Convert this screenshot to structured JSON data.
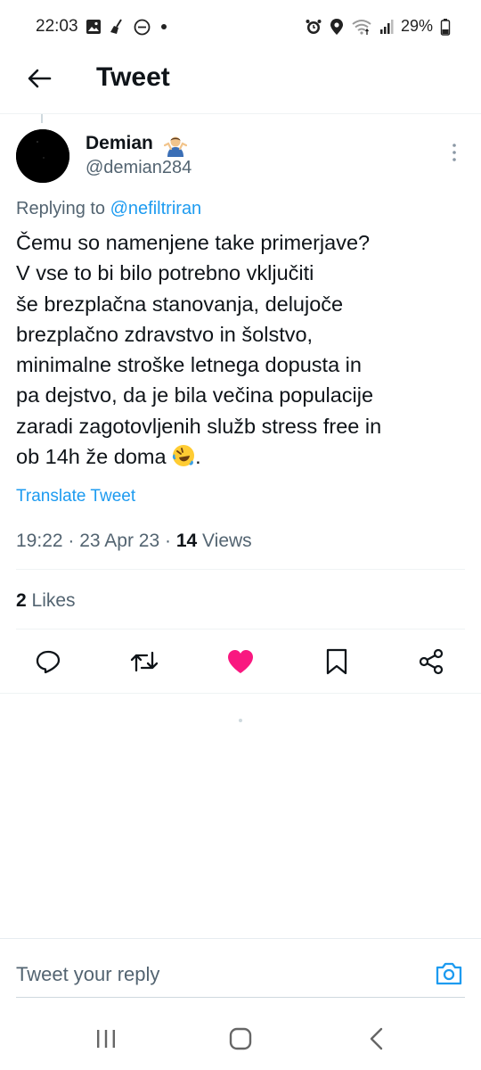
{
  "status_bar": {
    "time": "22:03",
    "battery": "29%",
    "left_icons": [
      "gallery-icon",
      "broom-icon",
      "do-not-disturb-icon",
      "dot-icon"
    ],
    "right_icons": [
      "alarm-icon",
      "location-icon",
      "wifi-icon",
      "signal-icon",
      "battery-icon"
    ]
  },
  "header": {
    "title": "Tweet",
    "back_icon": "arrow-left-icon"
  },
  "tweet": {
    "author_name": "Demian",
    "author_emoji": "person-shrugging-emoji",
    "author_handle": "@demian284",
    "replying_prefix": "Replying to",
    "replying_to": "@nefiltriran",
    "text_lines": [
      "Čemu so namenjene take primerjave?",
      "V vse to bi bilo potrebno vključiti",
      "še brezplačna stanovanja, delujoče",
      "brezplačno zdravstvo in šolstvo,",
      "minimalne stroške letnega dopusta in",
      "pa dejstvo, da je bila večina populacije",
      "zaradi zagotovljenih služb stress free in",
      "ob 14h že doma",
      "."
    ],
    "text_emoji": "rolling-on-floor-laughing-emoji",
    "translate_label": "Translate Tweet",
    "time": "19:22",
    "date": "23 Apr 23",
    "separator": "·",
    "views_count": "14",
    "views_label": "Views",
    "likes_count": "2",
    "likes_label": "Likes",
    "liked": true
  },
  "actions": [
    {
      "name": "reply",
      "icon": "speech-bubble-icon"
    },
    {
      "name": "retweet",
      "icon": "retweet-icon"
    },
    {
      "name": "like",
      "icon": "heart-icon"
    },
    {
      "name": "bookmark",
      "icon": "bookmark-icon"
    },
    {
      "name": "share",
      "icon": "share-icon"
    }
  ],
  "reply": {
    "placeholder": "Tweet your reply",
    "camera_icon": "camera-icon"
  },
  "nav": {
    "recent_icon": "recent-apps-icon",
    "home_icon": "home-icon",
    "back_icon": "back-chevron-icon"
  },
  "colors": {
    "accent": "#1d9bf0",
    "like": "#f91880",
    "text": "#0f1419",
    "secondary": "#536471",
    "divider": "#eff3f4"
  }
}
